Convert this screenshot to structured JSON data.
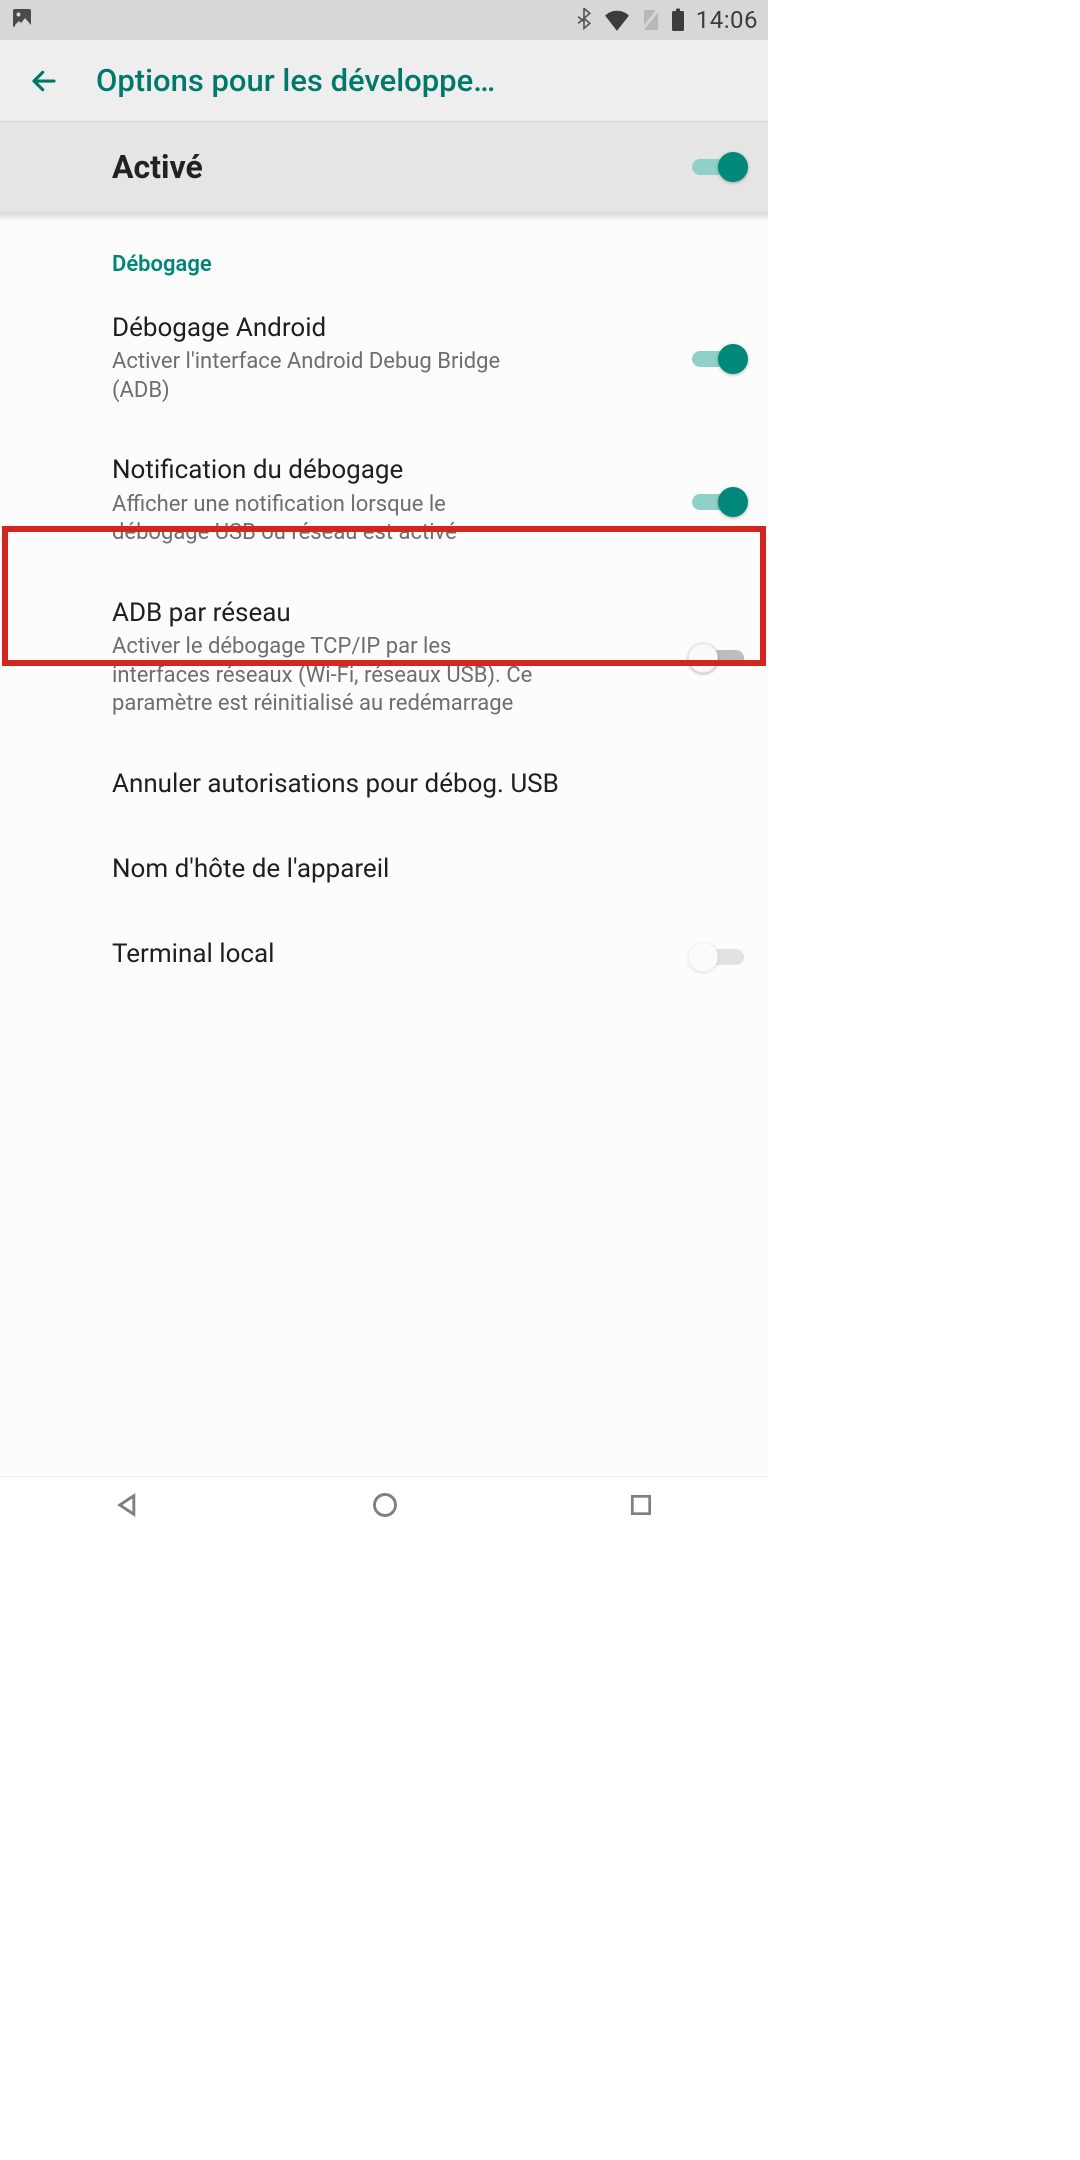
{
  "status": {
    "time": "14:06"
  },
  "appbar": {
    "title": "Options pour les développe…"
  },
  "master": {
    "label": "Activé",
    "enabled": true
  },
  "section": {
    "debug_title": "Débogage"
  },
  "settings": {
    "android_debug": {
      "title": "Débogage Android",
      "sub": "Activer l'interface Android Debug Bridge (ADB)",
      "on": true
    },
    "debug_notif": {
      "title": "Notification du débogage",
      "sub": "Afficher une notification lorsque le débogage USB ou réseau est activé",
      "on": true
    },
    "adb_net": {
      "title": "ADB par réseau",
      "sub": "Activer le débogage TCP/IP par les interfaces réseaux (Wi-Fi, réseaux USB). Ce paramètre est réinitialisé au redémarrage",
      "on": false
    },
    "revoke": {
      "title": "Annuler autorisations pour débog. USB"
    },
    "hostname": {
      "title": "Nom d'hôte de l'appareil"
    },
    "terminal": {
      "title": "Terminal local"
    }
  }
}
